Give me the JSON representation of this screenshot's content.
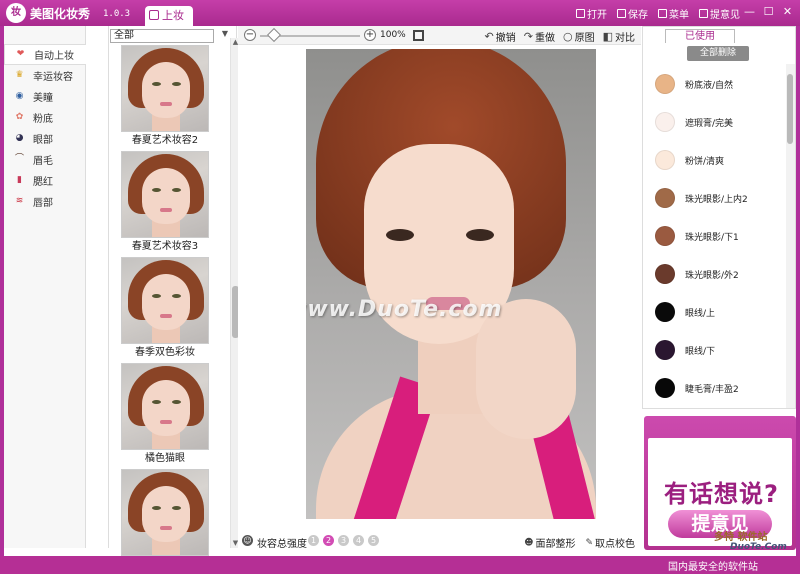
{
  "app": {
    "logo_char": "妆",
    "title": "美图化妆秀",
    "version": "1.0.3",
    "tab": "上妆"
  },
  "menu": [
    {
      "label": "打开",
      "icon": "folder-open-icon"
    },
    {
      "label": "保存",
      "icon": "save-icon"
    },
    {
      "label": "菜单",
      "icon": "menu-icon"
    },
    {
      "label": "提意见",
      "icon": "feedback-icon"
    }
  ],
  "window_controls": {
    "minimize": "—",
    "maximize": "☐",
    "close": "✕"
  },
  "categories": [
    {
      "label": "自动上妆",
      "icon": "heart-icon",
      "glyph": "❤",
      "color": "#e05a5a"
    },
    {
      "label": "幸运妆容",
      "icon": "crown-icon",
      "glyph": "♛",
      "color": "#d9a21a"
    },
    {
      "label": "美瞳",
      "icon": "eye-icon",
      "glyph": "◉",
      "color": "#3060a0"
    },
    {
      "label": "粉底",
      "icon": "foundation-icon",
      "glyph": "✿",
      "color": "#e07a6a"
    },
    {
      "label": "眼部",
      "icon": "eye-makeup-icon",
      "glyph": "◕",
      "color": "#333355"
    },
    {
      "label": "眉毛",
      "icon": "eyebrow-icon",
      "glyph": "⌒",
      "color": "#5a3a2a"
    },
    {
      "label": "腮红",
      "icon": "blush-icon",
      "glyph": "▮",
      "color": "#c83a5a"
    },
    {
      "label": "唇部",
      "icon": "lips-icon",
      "glyph": "≋",
      "color": "#c82a3a"
    }
  ],
  "template_filter": {
    "value": "全部"
  },
  "templates": [
    {
      "label": "春夏艺术妆容2"
    },
    {
      "label": "春夏艺术妆容3"
    },
    {
      "label": "春季双色彩妆"
    },
    {
      "label": "橘色猫眼"
    },
    {
      "label": ""
    }
  ],
  "toolbar": {
    "zoom": "100%",
    "zoom_minus": "−",
    "zoom_plus": "+",
    "undo": "撤销",
    "redo": "重做",
    "original": "原图",
    "compare": "对比"
  },
  "image": {
    "watermark": "www.DuoTe.com"
  },
  "bottom": {
    "intensity_label": "妆容总强度",
    "levels": [
      "1",
      "2",
      "3",
      "4",
      "5"
    ],
    "current_level": "2",
    "face_shape": "面部整形",
    "color_pick": "取点校色"
  },
  "used": {
    "tab": "已使用",
    "clear_all": "全部删除",
    "items": [
      {
        "label": "粉底液/自然",
        "color": "#e8b487"
      },
      {
        "label": "遮瑕膏/完美",
        "color": "#faf0ec"
      },
      {
        "label": "粉饼/清爽",
        "color": "#fbe9db"
      },
      {
        "label": "珠光眼影/上内2",
        "color": "#a06a48"
      },
      {
        "label": "珠光眼影/下1",
        "color": "#9a5a40"
      },
      {
        "label": "珠光眼影/外2",
        "color": "#6a3a2c"
      },
      {
        "label": "眼线/上",
        "color": "#0a0a0a"
      },
      {
        "label": "眼线/下",
        "color": "#2a1630"
      },
      {
        "label": "睫毛膏/丰盈2",
        "color": "#080808"
      }
    ]
  },
  "ad": {
    "headline": "有话想说?",
    "button": "提意见",
    "wm1": "多特 软件站",
    "wm2": "DuoTe.Com"
  },
  "status": {
    "text": "国内最安全的软件站"
  }
}
